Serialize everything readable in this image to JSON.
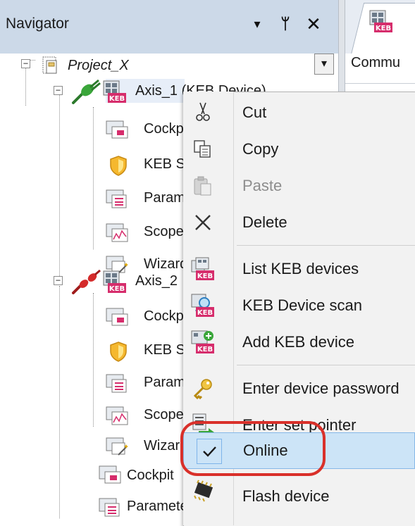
{
  "navigator": {
    "title": "Navigator",
    "buttons": {
      "dropdown": "▾",
      "pin": "ᛘ",
      "close": "✕"
    }
  },
  "document": {
    "tab_icon": "keb-device-icon",
    "subheader": "Commu"
  },
  "tree": {
    "project": {
      "label": "Project_X",
      "expander": "−"
    },
    "axis1": {
      "label": "Axis_1 (KEB Device)",
      "status": "online",
      "expander": "−",
      "children": [
        {
          "label": "Cockpit",
          "icon": "cockpit-icon"
        },
        {
          "label": "KEB Security",
          "icon": "shield-icon"
        },
        {
          "label": "Parameter",
          "icon": "parameter-icon"
        },
        {
          "label": "Scope",
          "icon": "scope-icon"
        },
        {
          "label": "Wizard",
          "icon": "wizard-icon"
        }
      ]
    },
    "axis2": {
      "label": "Axis_2",
      "status": "offline",
      "expander": "−",
      "children": [
        {
          "label": "Cockpit",
          "icon": "cockpit-icon"
        },
        {
          "label": "KEB Security",
          "icon": "shield-icon"
        },
        {
          "label": "Parameter",
          "icon": "parameter-icon"
        },
        {
          "label": "Scope",
          "icon": "scope-icon"
        },
        {
          "label": "Wizard",
          "icon": "wizard-icon"
        }
      ]
    },
    "root_items": [
      {
        "label": "Cockpit",
        "icon": "cockpit-icon"
      },
      {
        "label": "Parameter",
        "icon": "parameter-icon"
      }
    ]
  },
  "context_menu": {
    "items": [
      {
        "label": "Cut",
        "icon": "scissors-icon",
        "enabled": true
      },
      {
        "label": "Copy",
        "icon": "copy-icon",
        "enabled": true
      },
      {
        "label": "Paste",
        "icon": "paste-icon",
        "enabled": false
      },
      {
        "label": "Delete",
        "icon": "delete-x-icon",
        "enabled": true
      },
      {
        "label": "List KEB devices",
        "icon": "list-devices-icon",
        "enabled": true
      },
      {
        "label": "KEB Device scan",
        "icon": "device-scan-icon",
        "enabled": true
      },
      {
        "label": "Add KEB device",
        "icon": "add-device-icon",
        "enabled": true
      },
      {
        "label": "Enter device password",
        "icon": "key-icon",
        "enabled": true
      },
      {
        "label": "Enter set pointer",
        "icon": "set-pointer-icon",
        "enabled": true
      },
      {
        "label": "Online",
        "icon": "checkmark-icon",
        "enabled": true,
        "checked": true,
        "highlighted": true
      },
      {
        "label": "Flash device",
        "icon": "chip-icon",
        "enabled": true
      }
    ]
  },
  "colors": {
    "header_bg": "#ccd9e8",
    "highlight_bg": "#cce4f7",
    "highlight_border": "#86b8e8",
    "annotation_ring": "#d9302a",
    "plug_online": "#3aa63a",
    "plug_offline": "#d42a2a"
  }
}
